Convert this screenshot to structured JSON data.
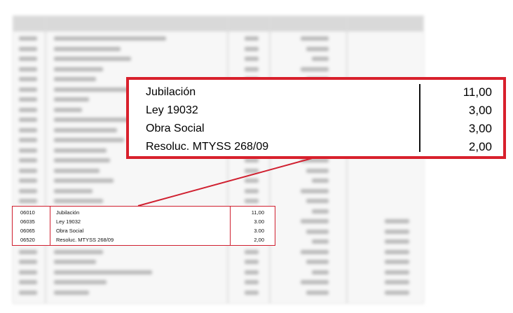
{
  "callout": {
    "rows": [
      {
        "concept": "Jubilación",
        "value": "11,00"
      },
      {
        "concept": "Ley 19032",
        "value": "3,00"
      },
      {
        "concept": "Obra Social",
        "value": "3,00"
      },
      {
        "concept": "Resoluc. MTYSS 268/09",
        "value": "2,00"
      }
    ]
  },
  "detail": {
    "rows": [
      {
        "code": "06010",
        "concept": "Jubilación",
        "value": "11,00"
      },
      {
        "code": "06035",
        "concept": "Ley 19032",
        "value": "3.00"
      },
      {
        "code": "06065",
        "concept": "Obra Social",
        "value": "3.00"
      },
      {
        "code": "06520",
        "concept": "Resoluc. MTYSS 268/09",
        "value": "2,00"
      }
    ]
  },
  "colors": {
    "highlight": "#d8202c"
  }
}
